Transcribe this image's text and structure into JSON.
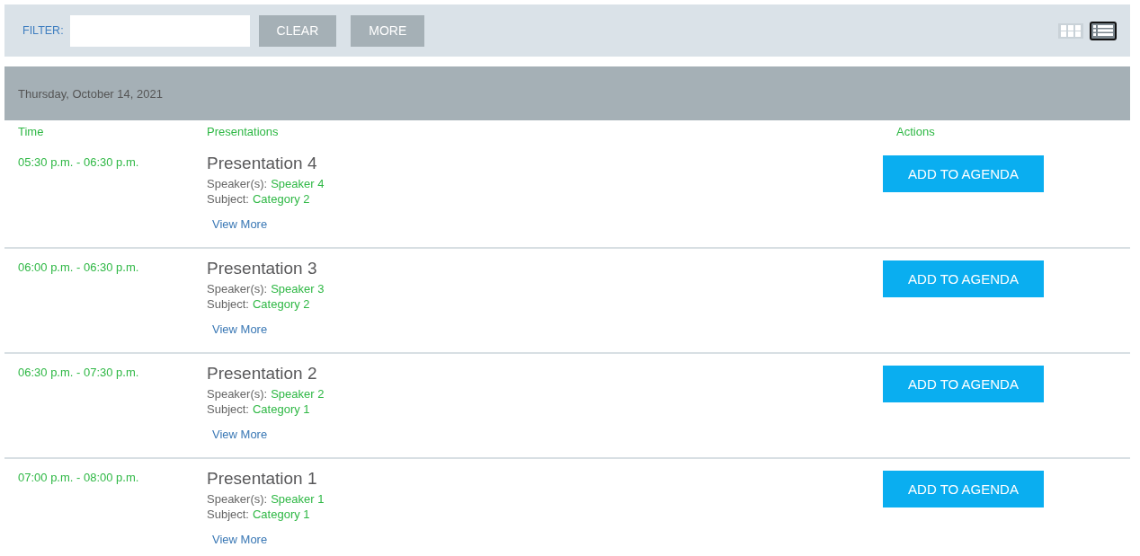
{
  "toolbar": {
    "filter_label": "FILTER:",
    "buttons": [
      "CLEAR",
      "MORE"
    ],
    "view_toggle": [
      {
        "kind": "grid",
        "selected": false
      },
      {
        "kind": "list",
        "selected": true
      }
    ]
  },
  "schedule": {
    "date": "Thursday, October 14, 2021",
    "columns": [
      "Time",
      "Presentations",
      "Actions"
    ],
    "rows": [
      {
        "time": "05:30 p.m. - 06:30 p.m.",
        "title": "Presentation 4",
        "speakers_label": "Speaker(s):",
        "speakers": "Speaker 4",
        "subject_label": "Subject:",
        "subject": "Category 2",
        "link": "View More",
        "action": "ADD TO AGENDA"
      },
      {
        "time": "06:00 p.m. - 06:30 p.m.",
        "title": "Presentation 3",
        "speakers_label": "Speaker(s):",
        "speakers": "Speaker 3",
        "subject_label": "Subject:",
        "subject": "Category 2",
        "link": "View More",
        "action": "ADD TO AGENDA"
      },
      {
        "time": "06:30 p.m. - 07:30 p.m.",
        "title": "Presentation 2",
        "speakers_label": "Speaker(s):",
        "speakers": "Speaker 2",
        "subject_label": "Subject:",
        "subject": "Category 1",
        "link": "View More",
        "action": "ADD TO AGENDA"
      },
      {
        "time": "07:00 p.m. - 08:00 p.m.",
        "title": "Presentation 1",
        "speakers_label": "Speaker(s):",
        "speakers": "Speaker 1",
        "subject_label": "Subject:",
        "subject": "Category 1",
        "link": "View More",
        "action": "ADD TO AGENDA"
      }
    ]
  }
}
